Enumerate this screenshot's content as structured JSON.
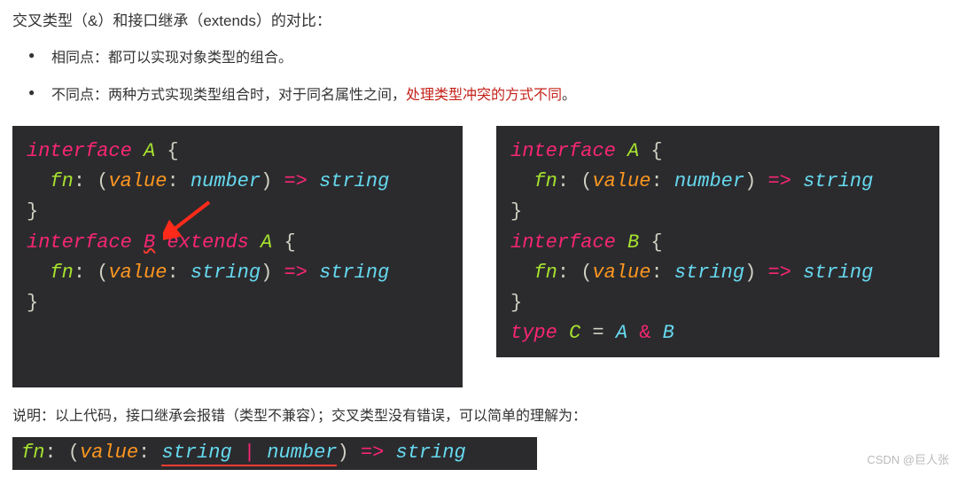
{
  "heading": "交叉类型（&）和接口继承（extends）的对比：",
  "bullets": [
    {
      "label": "相同点：都可以实现对象类型的组合。"
    },
    {
      "prefix": "不同点：两种方式实现类型组合时，对于同名属性之间，",
      "emphasis": "处理类型冲突的方式不同",
      "suffix": "。"
    }
  ],
  "code_left": {
    "l1_kw": "interface",
    "l1_name": "A",
    "l1_brace": " {",
    "l2_prop": "fn",
    "l2_colon": ": (",
    "l2_param": "value",
    "l2_pcol": ": ",
    "l2_ptype": "number",
    "l2_rp": ") ",
    "l2_arrow": "=>",
    "l2_ret": " string",
    "l3": "}",
    "l4_kw": "interface",
    "l4_name": "B",
    "l4_ext": " extends",
    "l4_sup": " A",
    "l4_brace": " {",
    "l5_prop": "fn",
    "l5_colon": ": (",
    "l5_param": "value",
    "l5_pcol": ": ",
    "l5_ptype": "string",
    "l5_rp": ") ",
    "l5_arrow": "=>",
    "l5_ret": " string",
    "l6": "}"
  },
  "code_right": {
    "l1_kw": "interface",
    "l1_name": "A",
    "l1_brace": " {",
    "l2_prop": "fn",
    "l2_colon": ": (",
    "l2_param": "value",
    "l2_pcol": ": ",
    "l2_ptype": "number",
    "l2_rp": ") ",
    "l2_arrow": "=>",
    "l2_ret": " string",
    "l3": "}",
    "l4_kw": "interface",
    "l4_name": "B",
    "l4_brace": " {",
    "l5_prop": "fn",
    "l5_colon": ": (",
    "l5_param": "value",
    "l5_pcol": ": ",
    "l5_ptype": "string",
    "l5_rp": ") ",
    "l5_arrow": "=>",
    "l5_ret": " string",
    "l6": "}",
    "l7_kw": "type",
    "l7_name": " C",
    "l7_eq": " = ",
    "l7_a": "A",
    "l7_amp": " & ",
    "l7_b": "B"
  },
  "note": "说明：以上代码，接口继承会报错（类型不兼容）；交叉类型没有错误，可以简单的理解为：",
  "code_bottom": {
    "prop": "fn",
    "colon": ": (",
    "param": "value",
    "pcol": ": ",
    "t1": "string",
    "pipe": " | ",
    "t2": "number",
    "rp": ") ",
    "arrow": "=>",
    "ret": " string"
  },
  "watermark": "CSDN @巨人张"
}
